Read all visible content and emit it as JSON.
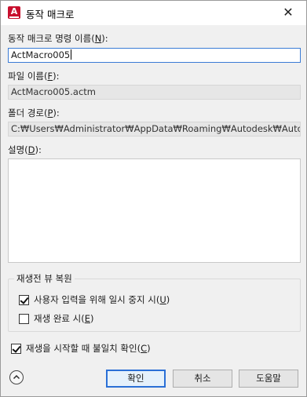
{
  "window": {
    "title": "동작 매크로",
    "app_icon_letter": "A",
    "close_symbol": "✕"
  },
  "macro_name": {
    "label": "동작 매크로 명령 이름",
    "mnemonic": "N",
    "value": "ActMacro005"
  },
  "file_name": {
    "label": "파일 이름",
    "mnemonic": "F",
    "value": "ActMacro005.actm"
  },
  "folder_path": {
    "label": "폴더 경로",
    "mnemonic": "P",
    "value": "C:₩Users₩Administrator₩AppData₩Roaming₩Autodesk₩AutoCAD"
  },
  "description": {
    "label": "설명",
    "mnemonic": "D",
    "value": ""
  },
  "restore_group": {
    "title": "재생전 뷰 복원",
    "pause_for_input": {
      "label": "사용자 입력을 위해 일시 중지 시",
      "mnemonic": "U",
      "checked": true
    },
    "on_playback_complete": {
      "label": "재생 완료 시",
      "mnemonic": "E",
      "checked": false
    }
  },
  "check_mismatch": {
    "label": "재생을 시작할 때 불일치 확인",
    "mnemonic": "C",
    "checked": true
  },
  "buttons": {
    "ok": "확인",
    "cancel": "취소",
    "help": "도움말"
  },
  "colors": {
    "accent": "#2a6fd6",
    "brand_red": "#c8102e"
  }
}
